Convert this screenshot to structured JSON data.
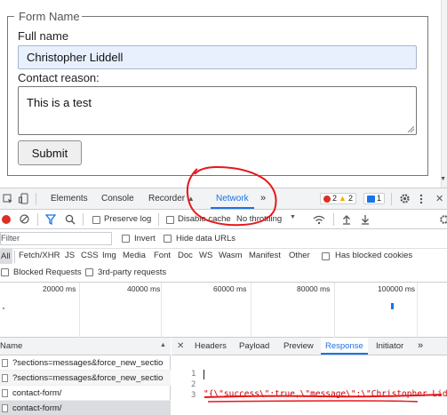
{
  "form": {
    "legend": "Form Name",
    "name_label": "Full name",
    "name_value": "Christopher Liddell",
    "reason_label": "Contact reason:",
    "reason_value": "This is a test",
    "submit_label": "Submit"
  },
  "devtools": {
    "tabs": [
      "Elements",
      "Console",
      "Recorder",
      "Network"
    ],
    "active_tab": "Network",
    "more_tabs": "»",
    "error_count": "2",
    "warning_count": "2",
    "message_count": "1",
    "toolbar": {
      "preserve_log": "Preserve log",
      "disable_cache": "Disable cache",
      "throttling": "No throttling"
    },
    "filter": {
      "placeholder": "Filter",
      "invert": "Invert",
      "hide_data_urls": "Hide data URLs"
    },
    "types": [
      "All",
      "Fetch/XHR",
      "JS",
      "CSS",
      "Img",
      "Media",
      "Font",
      "Doc",
      "WS",
      "Wasm",
      "Manifest",
      "Other"
    ],
    "has_blocked_cookies": "Has blocked cookies",
    "blocked_requests": "Blocked Requests",
    "third_party": "3rd-party requests",
    "timeline_ticks": [
      "20000 ms",
      "40000 ms",
      "60000 ms",
      "80000 ms",
      "100000 ms"
    ],
    "requests_header": "Name",
    "requests": [
      "?sections=messages&force_new_section_timestamp=true",
      "?sections=messages&force_new_section_timestamp=true",
      "contact-form/",
      "contact-form/"
    ],
    "detail_tabs": [
      "Headers",
      "Payload",
      "Preview",
      "Response",
      "Initiator"
    ],
    "active_detail_tab": "Response",
    "response_lines": [
      "1",
      "2",
      "3"
    ],
    "response_text": "\"{\\\"success\\\":true,\\\"message\\\":\\\"Christopher Liddell"
  },
  "colors": {
    "accent": "#1a73e8",
    "error": "#d93025",
    "warning": "#f9ab00",
    "annotation": "#e8171b",
    "response_text": "#c80000"
  }
}
